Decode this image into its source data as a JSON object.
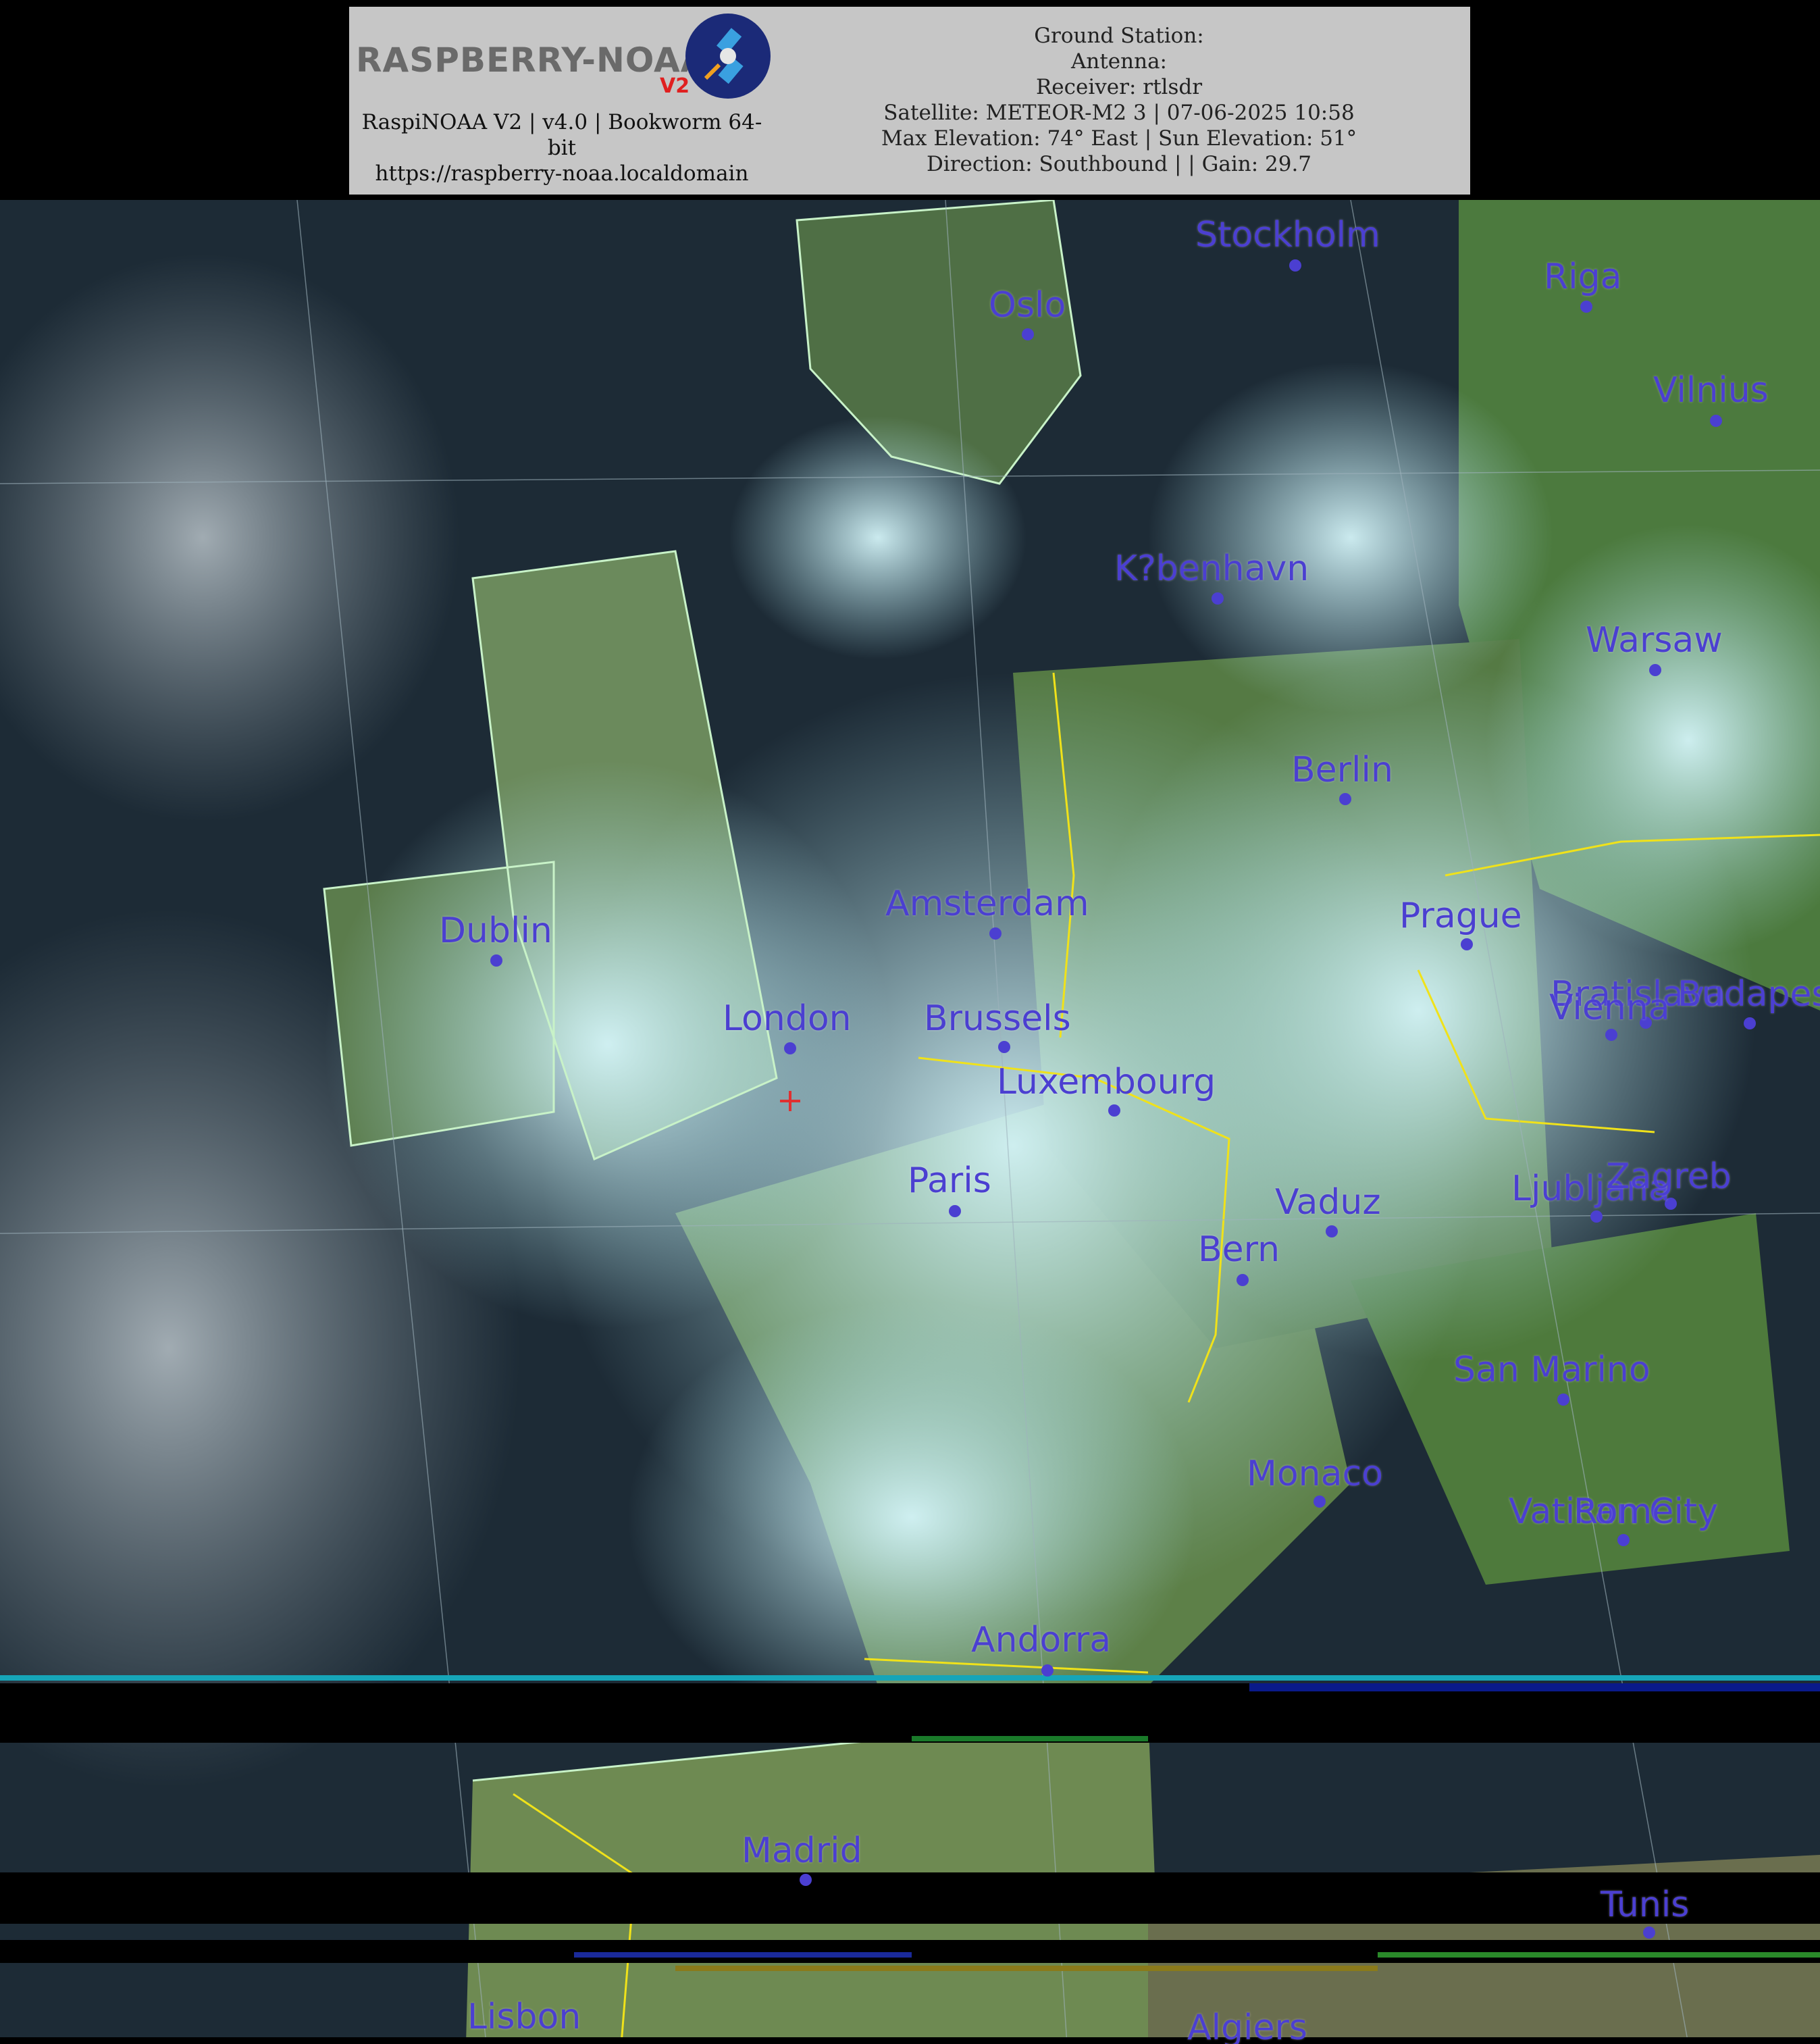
{
  "header": {
    "logo_text": "RASPBERRY-NOAA",
    "logo_version": "V2",
    "software_line": "RaspiNOAA V2 | v4.0 | Bookworm 64-bit",
    "url": "https://raspberry-noaa.localdomain",
    "ground_station": "Ground Station:",
    "antenna": "Antenna:",
    "receiver": "Receiver: rtlsdr",
    "satellite": "Satellite: METEOR-M2 3 | 07-06-2025 10:58",
    "elevation": "Max Elevation: 74° East | Sun Elevation: 51°",
    "direction": "Direction: Southbound | | Gain: 29.7"
  },
  "cities": [
    {
      "id": "stockholm",
      "name": "Stockholm"
    },
    {
      "id": "riga",
      "name": "Riga"
    },
    {
      "id": "oslo",
      "name": "Oslo"
    },
    {
      "id": "vilnius",
      "name": "Vilnius"
    },
    {
      "id": "kobenhavn",
      "name": "K?benhavn"
    },
    {
      "id": "warsaw",
      "name": "Warsaw"
    },
    {
      "id": "berlin",
      "name": "Berlin"
    },
    {
      "id": "amsterdam",
      "name": "Amsterdam"
    },
    {
      "id": "prague",
      "name": "Prague"
    },
    {
      "id": "dublin",
      "name": "Dublin"
    },
    {
      "id": "bratislava",
      "name": "Bratislava"
    },
    {
      "id": "vienna",
      "name": "Vienna"
    },
    {
      "id": "budapest",
      "name": "Budapest"
    },
    {
      "id": "london",
      "name": "London"
    },
    {
      "id": "brussels",
      "name": "Brussels"
    },
    {
      "id": "luxembourg",
      "name": "Luxembourg"
    },
    {
      "id": "paris",
      "name": "Paris"
    },
    {
      "id": "vaduz",
      "name": "Vaduz"
    },
    {
      "id": "ljubljana",
      "name": "Ljubljana"
    },
    {
      "id": "zagreb",
      "name": "Zagreb"
    },
    {
      "id": "bern",
      "name": "Bern"
    },
    {
      "id": "san-marino",
      "name": "San Marino"
    },
    {
      "id": "monaco",
      "name": "Monaco"
    },
    {
      "id": "vatican-city",
      "name": "Vatican City"
    },
    {
      "id": "rome",
      "name": "Rome"
    },
    {
      "id": "andorra",
      "name": "Andorra"
    },
    {
      "id": "madrid",
      "name": "Madrid"
    },
    {
      "id": "tunis",
      "name": "Tunis"
    },
    {
      "id": "lisbon",
      "name": "Lisbon"
    },
    {
      "id": "algiers",
      "name": "Algiers"
    }
  ],
  "colors": {
    "city_label": "#4b3fd1",
    "coastline": "#c8f2c8",
    "border": "#f0e21a",
    "cloud": "#bfe9ef",
    "land": "#4f7a3f",
    "sea": "#1d2b36"
  }
}
